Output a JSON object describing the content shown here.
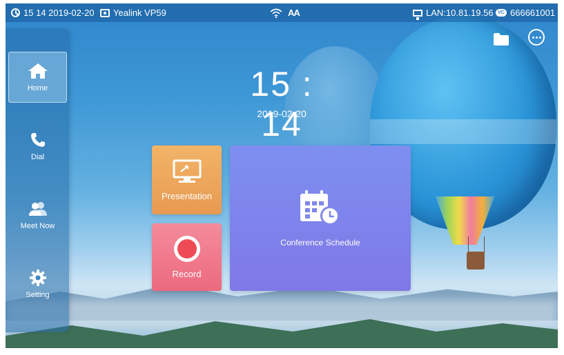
{
  "statusbar": {
    "time_date": "15 14 2019-02-20",
    "device": "Yealink VP59",
    "font_label": "AA",
    "lan": "LAN:10.81.19.56",
    "vc_badge": "VC",
    "vc_number": "666661001"
  },
  "sidebar": {
    "items": [
      {
        "label": "Home",
        "icon": "home-icon",
        "active": true
      },
      {
        "label": "Dial",
        "icon": "phone-icon",
        "active": false
      },
      {
        "label": "Meet Now",
        "icon": "people-icon",
        "active": false
      },
      {
        "label": "Setting",
        "icon": "gear-icon",
        "active": false
      }
    ]
  },
  "main": {
    "clock": "15 : 14",
    "date": "2019-02-20"
  },
  "tiles": {
    "presentation": "Presentation",
    "record": "Record",
    "schedule": "Conference Schedule"
  },
  "colors": {
    "presentation": "#e9a05a",
    "record": "#ef7588",
    "schedule": "#7f87ec",
    "record_dot": "#ef4b56"
  }
}
